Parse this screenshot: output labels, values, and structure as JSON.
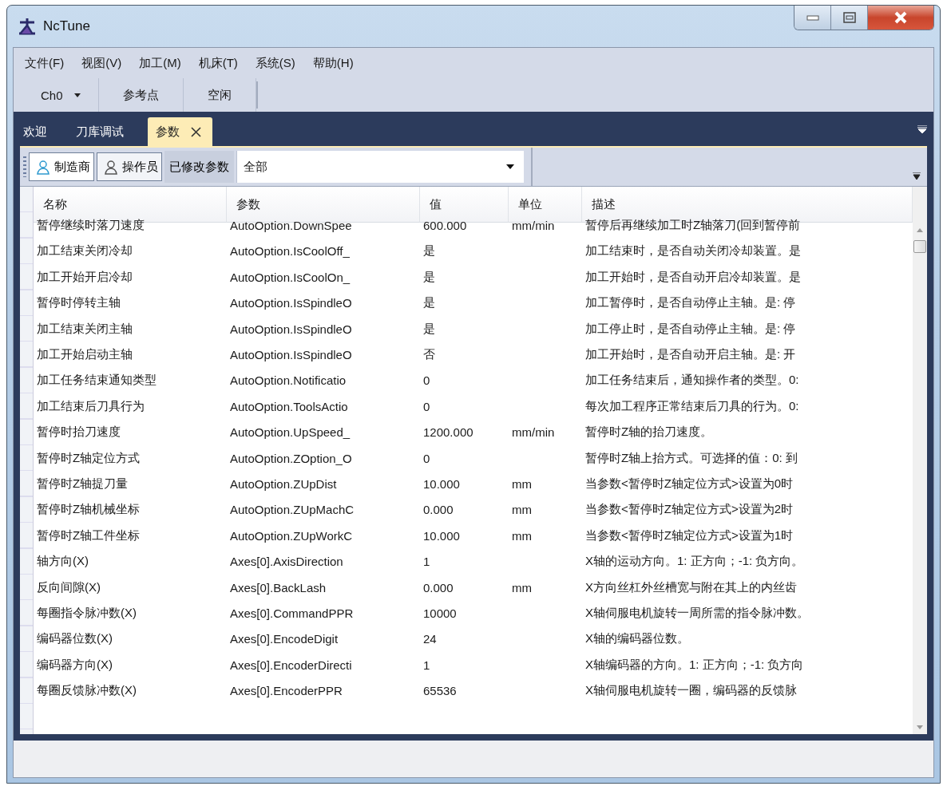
{
  "window": {
    "title": "NcTune"
  },
  "menu": [
    "文件(F)",
    "视图(V)",
    "加工(M)",
    "机床(T)",
    "系统(S)",
    "帮助(H)"
  ],
  "toolbar": {
    "channel": "Ch0",
    "buttons": [
      "参考点",
      "空闲"
    ]
  },
  "tabs": [
    {
      "label": "欢迎",
      "selected": false
    },
    {
      "label": "刀库调试",
      "selected": false
    },
    {
      "label": "参数",
      "selected": true
    }
  ],
  "filter_bar": {
    "roles": [
      {
        "label": "制造商",
        "selected": true
      },
      {
        "label": "操作员",
        "selected": false
      }
    ],
    "modified_button": "已修改参数",
    "category": "全部"
  },
  "table": {
    "columns": [
      "名称",
      "参数",
      "值",
      "单位",
      "描述"
    ],
    "rows": [
      {
        "name": "暂停继续时落刀速度",
        "param": "AutoOption.DownSpee",
        "value": "600.000",
        "unit": "mm/min",
        "description": "暂停后再继续加工时Z轴落刀(回到暂停前"
      },
      {
        "name": "加工结束关闭冷却",
        "param": "AutoOption.IsCoolOff_",
        "value": "是",
        "description": "加工结束时，是否自动关闭冷却装置。是"
      },
      {
        "name": "加工开始开启冷却",
        "param": "AutoOption.IsCoolOn_",
        "value": "是",
        "description": "加工开始时，是否自动开启冷却装置。是"
      },
      {
        "name": "暂停时停转主轴",
        "param": "AutoOption.IsSpindleO",
        "value": "是",
        "description": "加工暂停时，是否自动停止主轴。是: 停"
      },
      {
        "name": "加工结束关闭主轴",
        "param": "AutoOption.IsSpindleO",
        "value": "是",
        "description": "加工停止时，是否自动停止主轴。是: 停"
      },
      {
        "name": "加工开始启动主轴",
        "param": "AutoOption.IsSpindleO",
        "value": "否",
        "description": "加工开始时，是否自动开启主轴。是: 开"
      },
      {
        "name": "加工任务结束通知类型",
        "param": "AutoOption.Notificatio",
        "value": "0",
        "description": "加工任务结束后，通知操作者的类型。0:"
      },
      {
        "name": "加工结束后刀具行为",
        "param": "AutoOption.ToolsActio",
        "value": "0",
        "description": "每次加工程序正常结束后刀具的行为。0:"
      },
      {
        "name": "暂停时抬刀速度",
        "param": "AutoOption.UpSpeed_",
        "value": "1200.000",
        "unit": "mm/min",
        "description": "暂停时Z轴的抬刀速度。"
      },
      {
        "name": "暂停时Z轴定位方式",
        "param": "AutoOption.ZOption_O",
        "value": "0",
        "description": "暂停时Z轴上抬方式。可选择的值：0: 到"
      },
      {
        "name": "暂停时Z轴提刀量",
        "param": "AutoOption.ZUpDist",
        "value": "10.000",
        "unit": "mm",
        "description": "当参数<暂停时Z轴定位方式>设置为0时"
      },
      {
        "name": "暂停时Z轴机械坐标",
        "param": "AutoOption.ZUpMachC",
        "value": "0.000",
        "unit": "mm",
        "description": "当参数<暂停时Z轴定位方式>设置为2时"
      },
      {
        "name": "暂停时Z轴工件坐标",
        "param": "AutoOption.ZUpWorkC",
        "value": "10.000",
        "unit": "mm",
        "description": "当参数<暂停时Z轴定位方式>设置为1时"
      },
      {
        "name": "轴方向(X)",
        "param": "Axes[0].AxisDirection",
        "value": "1",
        "description": "X轴的运动方向。1: 正方向；-1: 负方向。"
      },
      {
        "name": "反向间隙(X)",
        "param": "Axes[0].BackLash",
        "value": "0.000",
        "unit": "mm",
        "description": "X方向丝杠外丝槽宽与附在其上的内丝齿"
      },
      {
        "name": "每圈指令脉冲数(X)",
        "param": "Axes[0].CommandPPR",
        "value": "10000",
        "description": "X轴伺服电机旋转一周所需的指令脉冲数。"
      },
      {
        "name": "编码器位数(X)",
        "param": "Axes[0].EncodeDigit",
        "value": "24",
        "description": "X轴的编码器位数。"
      },
      {
        "name": "编码器方向(X)",
        "param": "Axes[0].EncoderDirecti",
        "value": "1",
        "description": "X轴编码器的方向。1: 正方向；-1: 负方向"
      },
      {
        "name": "每圈反馈脉冲数(X)",
        "param": "Axes[0].EncoderPPR",
        "value": "65536",
        "description": "X轴伺服电机旋转一圈，编码器的反馈脉"
      }
    ]
  }
}
